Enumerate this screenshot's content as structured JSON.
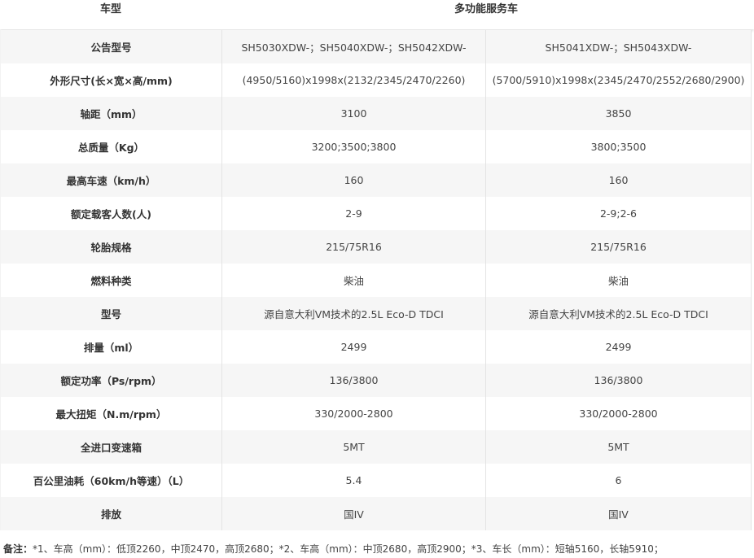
{
  "header": {
    "col1": "车型",
    "col2": "多功能服务车"
  },
  "rows": [
    {
      "label": "公告型号",
      "v1": "SH5030XDW-；SH5040XDW-；SH5042XDW-",
      "v2": "SH5041XDW-；SH5043XDW-"
    },
    {
      "label": "外形尺寸(长×宽×高/mm)",
      "v1": "(4950/5160)x1998x(2132/2345/2470/2260)",
      "v2": "(5700/5910)x1998x(2345/2470/2552/2680/2900)"
    },
    {
      "label": "轴距（mm）",
      "v1": "3100",
      "v2": "3850"
    },
    {
      "label": "总质量（Kg）",
      "v1": "3200;3500;3800",
      "v2": "3800;3500"
    },
    {
      "label": "最高车速（km/h）",
      "v1": "160",
      "v2": "160"
    },
    {
      "label": "额定载客人数(人)",
      "v1": "2-9",
      "v2": "2-9;2-6"
    },
    {
      "label": "轮胎规格",
      "v1": "215/75R16",
      "v2": "215/75R16"
    },
    {
      "label": "燃料种类",
      "v1": "柴油",
      "v2": "柴油"
    },
    {
      "label": "型号",
      "v1": "源自意大利VM技术的2.5L Eco-D TDCI",
      "v2": "源自意大利VM技术的2.5L Eco-D TDCI"
    },
    {
      "label": "排量（ml）",
      "v1": "2499",
      "v2": "2499"
    },
    {
      "label": "额定功率（Ps/rpm）",
      "v1": "136/3800",
      "v2": "136/3800"
    },
    {
      "label": "最大扭矩（N.m/rpm）",
      "v1": "330/2000-2800",
      "v2": "330/2000-2800"
    },
    {
      "label": "全进口变速箱",
      "v1": "5MT",
      "v2": "5MT"
    },
    {
      "label": "百公里油耗（60km/h等速）（L）",
      "v1": "5.4",
      "v2": "6"
    },
    {
      "label": "排放",
      "v1": "国IV",
      "v2": "国IV"
    }
  ],
  "note": {
    "prefix": "备注：",
    "text": "*1、车高（mm）：低顶2260，中顶2470，高顶2680；*2、车高（mm）：中顶2680，高顶2900；*3、车长（mm）：短轴5160，长轴5910；"
  }
}
